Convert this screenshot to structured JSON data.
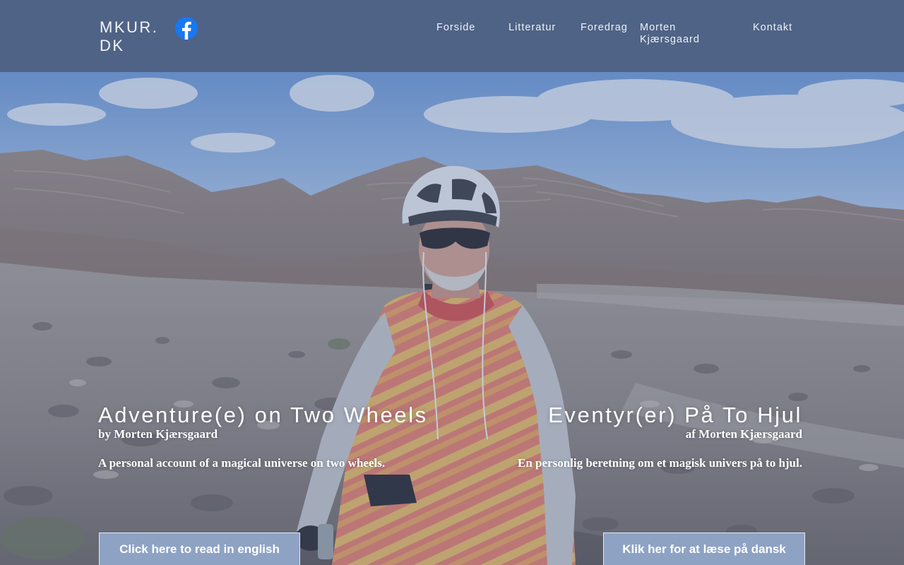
{
  "header": {
    "logo": "MKUR. DK",
    "nav": {
      "forside": "Forside",
      "litteratur": "Litteratur",
      "foredrag": "Foredrag",
      "morten": "Morten Kjærsgaard",
      "kontakt": "Kontakt"
    },
    "social_icon": "facebook-icon"
  },
  "hero": {
    "english": {
      "title": "Adventure(e) on Two Wheels",
      "byline": "by Morten Kjærsgaard",
      "description": "A personal account of a magical universe on two wheels.",
      "button": "Click here to read in english"
    },
    "danish": {
      "title": "Eventyr(er) På To Hjul",
      "byline": "af Morten Kjærsgaard",
      "description": "En personlig beretning om et magisk univers på to hjul.",
      "button": "Klik her for at læse på dansk"
    }
  },
  "colors": {
    "header_bg": "#4f6386",
    "button_bg": "#8ea2c4",
    "facebook_blue": "#1877f2",
    "text": "#ffffff"
  }
}
